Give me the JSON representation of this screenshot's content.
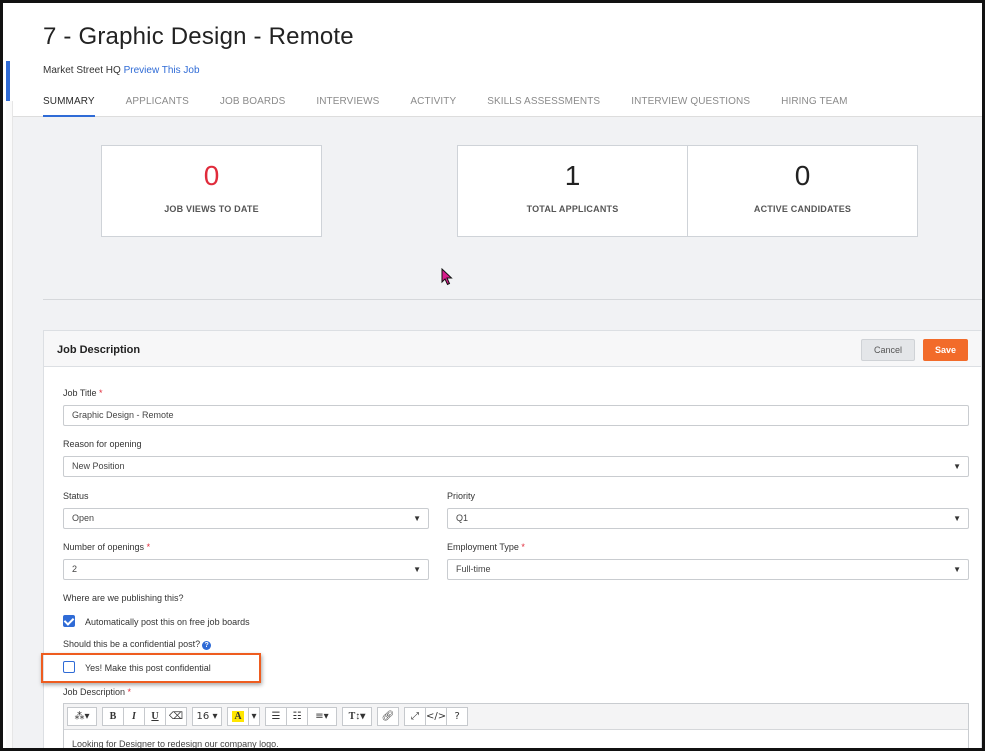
{
  "header": {
    "title": "7 - Graphic Design - Remote",
    "location": "Market Street HQ",
    "preview_link": "Preview This Job"
  },
  "tabs": [
    {
      "label": "SUMMARY",
      "active": true
    },
    {
      "label": "APPLICANTS"
    },
    {
      "label": "JOB BOARDS"
    },
    {
      "label": "INTERVIEWS"
    },
    {
      "label": "ACTIVITY"
    },
    {
      "label": "SKILLS ASSESSMENTS"
    },
    {
      "label": "INTERVIEW QUESTIONS"
    },
    {
      "label": "HIRING TEAM"
    }
  ],
  "stats": {
    "job_views": {
      "value": "0",
      "label": "JOB VIEWS TO DATE"
    },
    "total_applicants": {
      "value": "1",
      "label": "TOTAL APPLICANTS"
    },
    "active_candidates": {
      "value": "0",
      "label": "ACTIVE CANDIDATES"
    }
  },
  "panel": {
    "title": "Job Description",
    "cancel_label": "Cancel",
    "save_label": "Save"
  },
  "form": {
    "job_title": {
      "label": "Job Title",
      "value": "Graphic Design - Remote"
    },
    "reason": {
      "label": "Reason for opening",
      "value": "New Position"
    },
    "status": {
      "label": "Status",
      "value": "Open"
    },
    "priority": {
      "label": "Priority",
      "value": "Q1"
    },
    "openings": {
      "label": "Number of openings",
      "value": "2"
    },
    "employment_type": {
      "label": "Employment Type",
      "value": "Full-time"
    },
    "publishing_question": "Where are we publishing this?",
    "auto_post": {
      "label": "Automatically post this on free job boards",
      "checked": true
    },
    "confidential_question": "Should this be a confidential post?",
    "confidential": {
      "label": "Yes! Make this post confidential",
      "checked": false
    },
    "description": {
      "label": "Job Description",
      "font_size": "16",
      "text": "Looking for Designer to redesign our company logo."
    }
  },
  "colors": {
    "accent": "#2f6bd6",
    "save": "#f26b2a",
    "highlight_box": "#ee5c1f",
    "job_views_number": "#e02b3b"
  }
}
